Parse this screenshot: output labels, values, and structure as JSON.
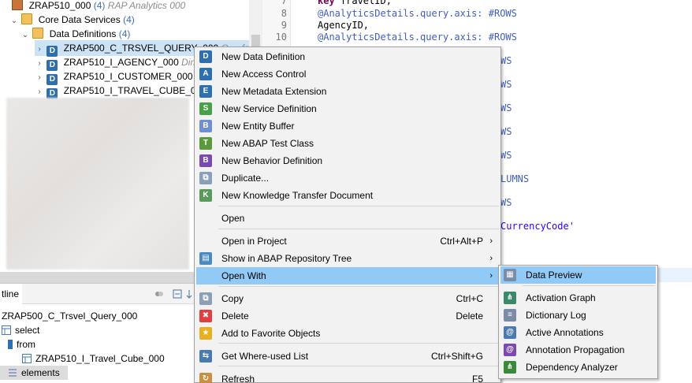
{
  "tree": {
    "package": {
      "label": "ZRAP510_000",
      "count": "(4)",
      "description": "RAP Analytics 000"
    },
    "core_data_services": {
      "label": "Core Data Services",
      "count": "(4)"
    },
    "data_definitions": {
      "label": "Data Definitions",
      "count": "(4)"
    },
    "items": [
      {
        "label": "ZRAP500_C_TRSVEL_QUERY_000",
        "desc": "Q ... for"
      },
      {
        "label": "ZRAP510_I_AGENCY_000",
        "desc": "Dime"
      },
      {
        "label": "ZRAP510_I_CUSTOMER_000",
        "desc": "Di"
      },
      {
        "label": "ZRAP510_I_TRAVEL_CUBE_000",
        "desc": ""
      }
    ]
  },
  "editor": {
    "line_numbers": [
      "7",
      "8",
      "9",
      "10"
    ],
    "lines": [
      {
        "kw": "key",
        "rest": " TravelID,"
      },
      {
        "ann": "@AnalyticsDetails.query.axis: #ROWS"
      },
      {
        "plain": "AgencyID,"
      },
      {
        "ann": "@AnalyticsDetails.query.axis: #ROWS"
      }
    ],
    "fragments": [
      "WS",
      "WS",
      "WS",
      "WS",
      "WS",
      "LUMNS",
      "WS",
      "CurrencyCode'"
    ]
  },
  "outline": {
    "tab_label": "tline",
    "root": "ZRAP500_C_Trsvel_Query_000",
    "select": "select",
    "from": "from",
    "source": "ZRAP510_I_Travel_Cube_000",
    "elements": "elements"
  },
  "context_menu": {
    "items": [
      {
        "label": "New Data Definition",
        "icon": "data-definition-icon",
        "color": "#2e6fb0",
        "glyph": "D"
      },
      {
        "label": "New Access Control",
        "icon": "access-control-icon",
        "color": "#2e6fb0",
        "glyph": "A"
      },
      {
        "label": "New Metadata Extension",
        "icon": "metadata-extension-icon",
        "color": "#2e6fb0",
        "glyph": "E"
      },
      {
        "label": "New Service Definition",
        "icon": "service-definition-icon",
        "color": "#4aa04a",
        "glyph": "S"
      },
      {
        "label": "New Entity Buffer",
        "icon": "entity-buffer-icon",
        "color": "#6e8fd0",
        "glyph": "B"
      },
      {
        "label": "New ABAP Test Class",
        "icon": "test-class-icon",
        "color": "#5a9a3a",
        "glyph": "T"
      },
      {
        "label": "New Behavior Definition",
        "icon": "behavior-definition-icon",
        "color": "#7a4ab0",
        "glyph": "B"
      },
      {
        "label": "Duplicate...",
        "icon": "duplicate-icon",
        "color": "#8aa0b8",
        "glyph": "⧉"
      },
      {
        "label": "New Knowledge Transfer Document",
        "icon": "knowledge-transfer-icon",
        "color": "#5a9a5a",
        "glyph": "K"
      },
      {
        "label": "Open"
      },
      {
        "label": "Open in Project",
        "shortcut": "Ctrl+Alt+P",
        "arrow": "›"
      },
      {
        "label": "Show in ABAP Repository Tree",
        "icon": "repository-tree-icon",
        "color": "#4a8ac0",
        "glyph": "▤",
        "arrow": "›"
      },
      {
        "label": "Open With",
        "arrow": "›"
      },
      {
        "label": "Copy",
        "shortcut": "Ctrl+C",
        "icon": "copy-icon",
        "color": "#8aa0b8",
        "glyph": "⧉"
      },
      {
        "label": "Delete",
        "shortcut": "Delete",
        "icon": "delete-icon",
        "color": "#e04040",
        "glyph": "✖"
      },
      {
        "label": "Add to Favorite Objects",
        "icon": "favorite-star-icon",
        "color": "#e8b020",
        "glyph": "★"
      },
      {
        "label": "Get Where-used List",
        "shortcut": "Ctrl+Shift+G",
        "icon": "where-used-icon",
        "color": "#4a7ab0",
        "glyph": "⇆"
      },
      {
        "label": "Refresh",
        "shortcut": "F5",
        "icon": "refresh-icon",
        "color": "#c89040",
        "glyph": "↻"
      }
    ]
  },
  "submenu": {
    "items": [
      {
        "label": "Data Preview",
        "icon": "data-preview-icon",
        "color": "#7a8ca8",
        "glyph": "▦"
      },
      {
        "label": "Activation Graph",
        "icon": "activation-graph-icon",
        "color": "#3a8a6a",
        "glyph": "⋔"
      },
      {
        "label": "Dictionary Log",
        "icon": "dictionary-log-icon",
        "color": "#7a8ca8",
        "glyph": "≡"
      },
      {
        "label": "Active Annotations",
        "icon": "annotations-icon",
        "color": "#4a7ab0",
        "glyph": "@"
      },
      {
        "label": "Annotation Propagation",
        "icon": "annotation-propagation-icon",
        "color": "#7a4ab0",
        "glyph": "@"
      },
      {
        "label": "Dependency Analyzer",
        "icon": "dependency-analyzer-icon",
        "color": "#3a8a3a",
        "glyph": "⋔"
      }
    ]
  }
}
